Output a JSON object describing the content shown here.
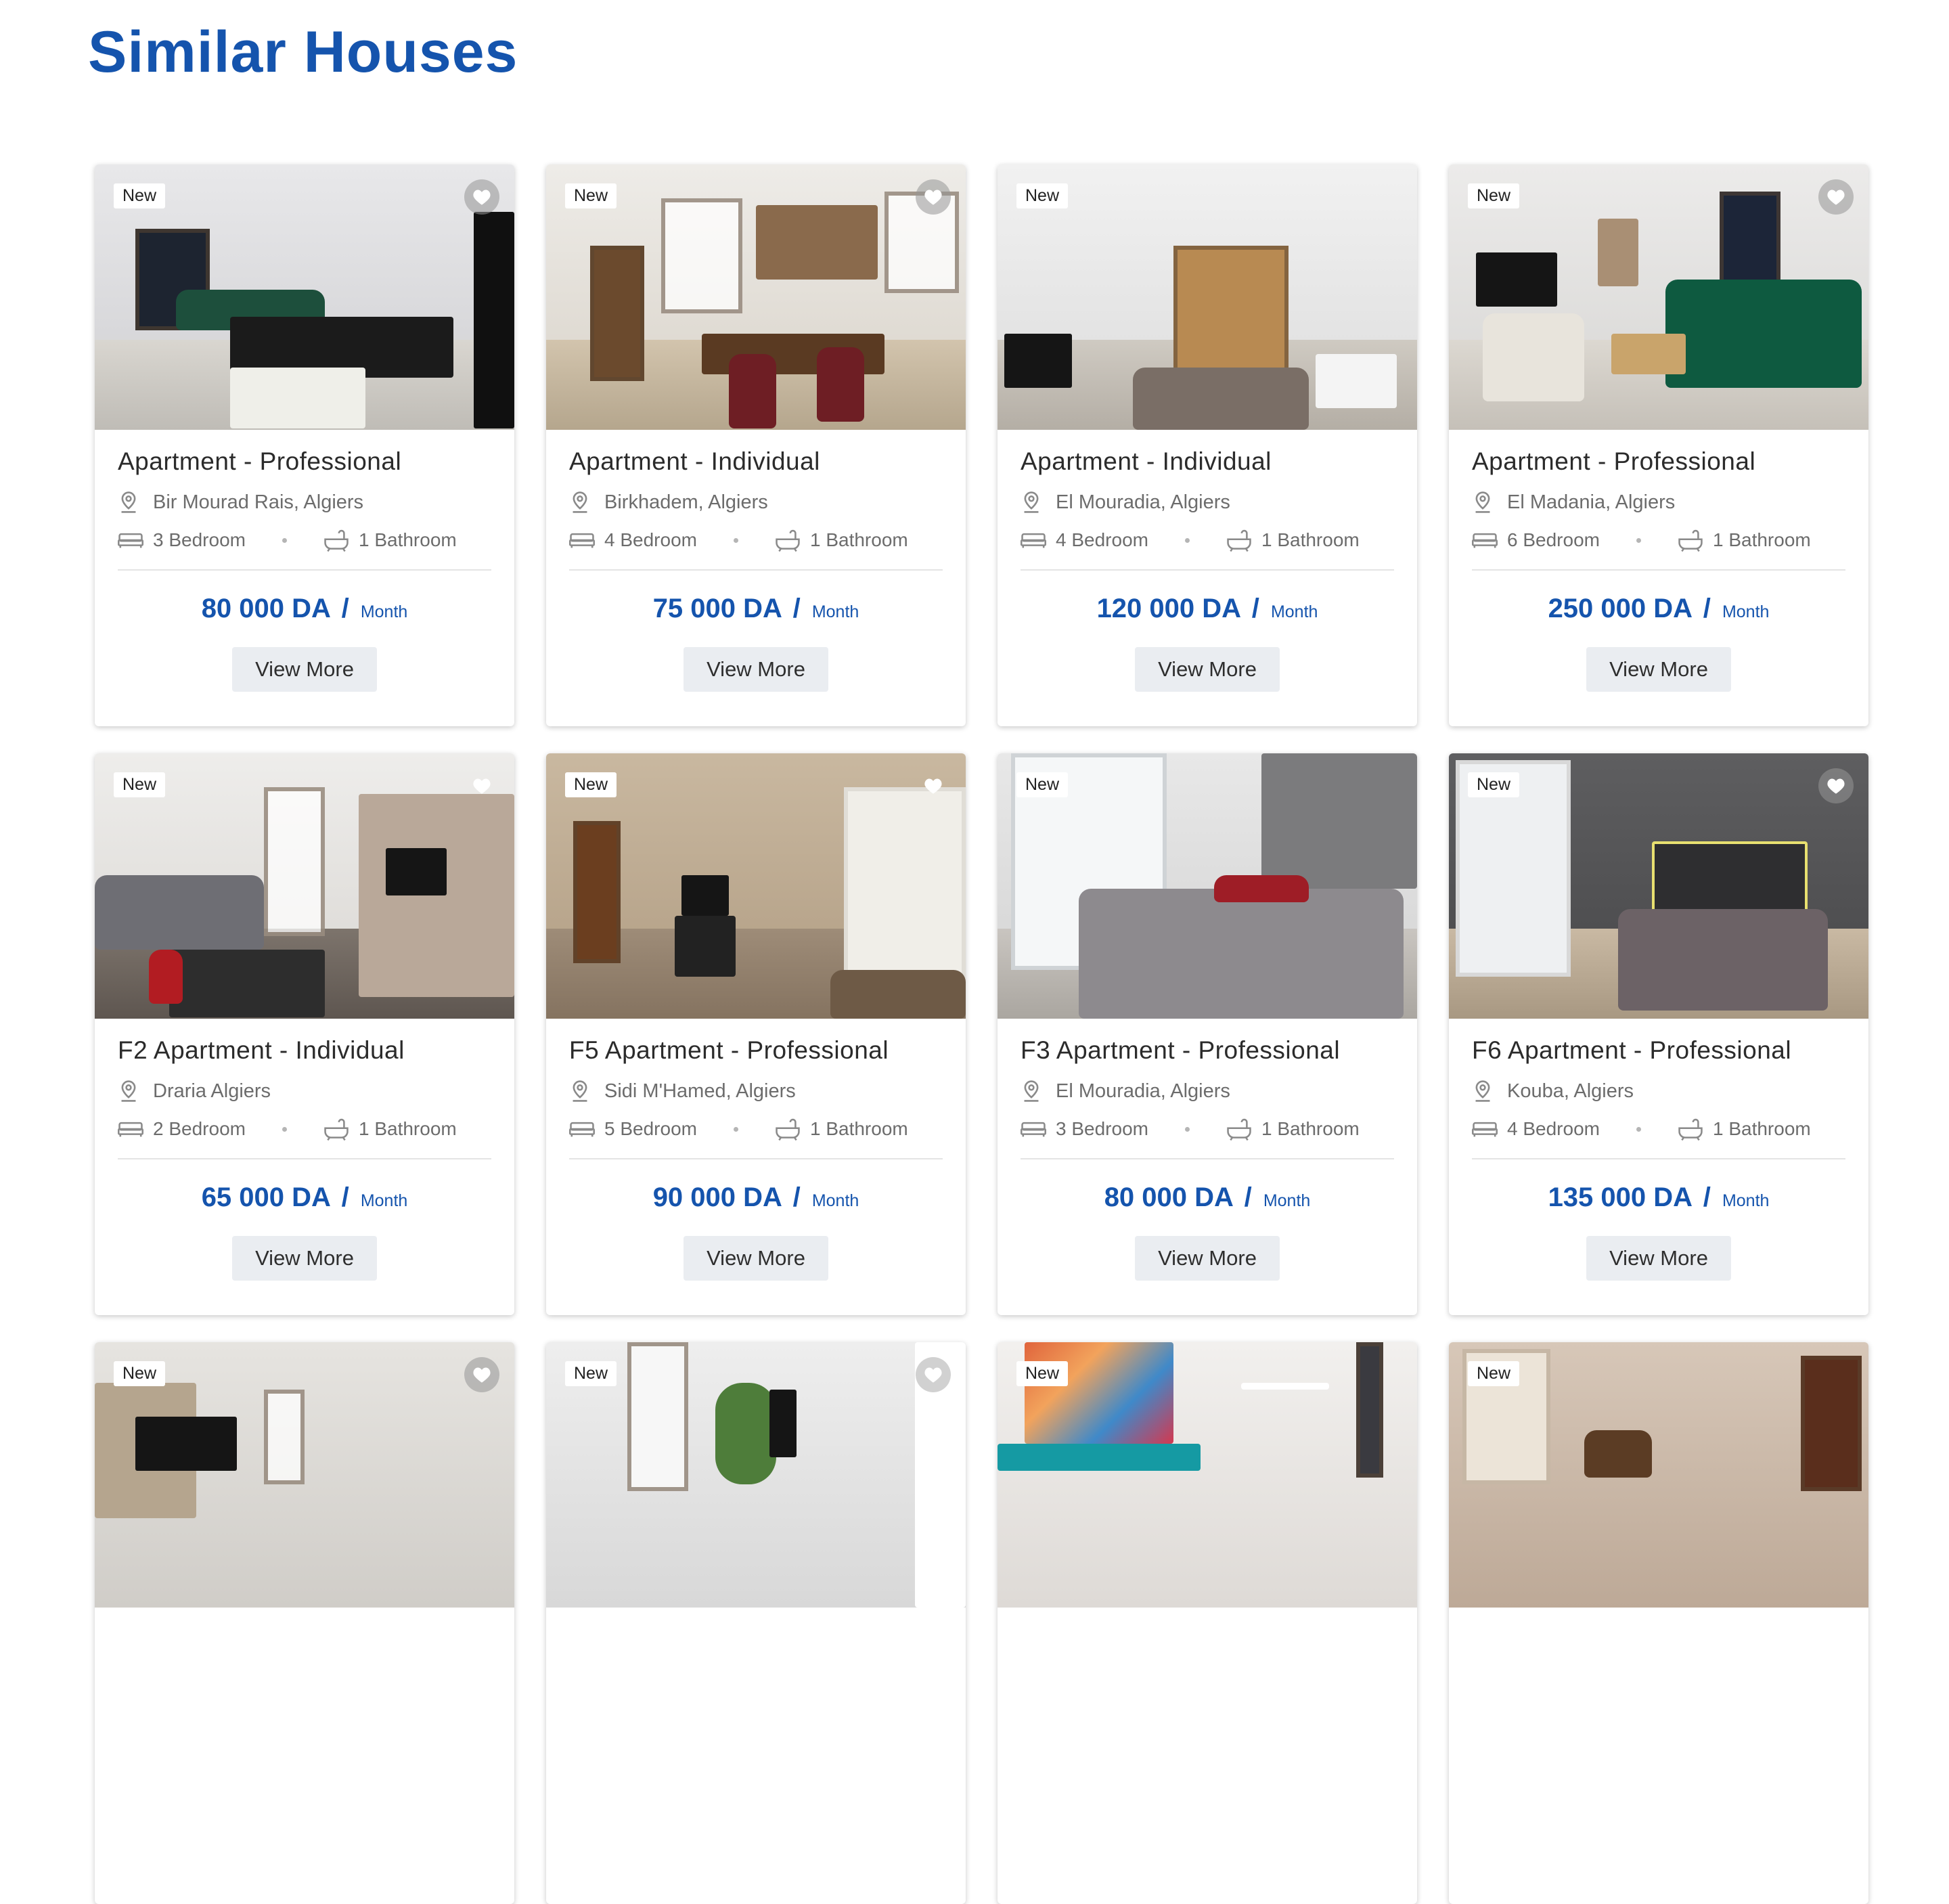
{
  "page": {
    "title": "Similar Houses"
  },
  "listings": [
    {
      "badge": "New",
      "title": "Apartment -  Professional",
      "location": "Bir Mourad Rais, Algiers",
      "bedrooms": "3 Bedroom",
      "bathrooms": "1 Bathroom",
      "price": "80 000 DA",
      "price_sep": "/",
      "price_unit": "Month",
      "cta": "View More"
    },
    {
      "badge": "New",
      "title": "Apartment - Individual",
      "location": "Birkhadem, Algiers",
      "bedrooms": "4 Bedroom",
      "bathrooms": "1 Bathroom",
      "price": "75 000 DA",
      "price_sep": "/",
      "price_unit": "Month",
      "cta": "View More"
    },
    {
      "badge": "New",
      "title": "Apartment -  Individual",
      "location": "El Mouradia, Algiers",
      "bedrooms": "4 Bedroom",
      "bathrooms": "1 Bathroom",
      "price": "120 000 DA",
      "price_sep": "/",
      "price_unit": "Month",
      "cta": "View More"
    },
    {
      "badge": "New",
      "title": "Apartment -  Professional",
      "location": "El Madania, Algiers",
      "bedrooms": "6 Bedroom",
      "bathrooms": "1 Bathroom",
      "price": "250 000 DA",
      "price_sep": "/",
      "price_unit": "Month",
      "cta": "View More"
    },
    {
      "badge": "New",
      "title": "F2 Apartment - Individual",
      "location": "Draria Algiers",
      "bedrooms": "2 Bedroom",
      "bathrooms": "1 Bathroom",
      "price": "65 000 DA",
      "price_sep": "/",
      "price_unit": "Month",
      "cta": "View More"
    },
    {
      "badge": "New",
      "title": "F5 Apartment -  Professional",
      "location": "Sidi M'Hamed, Algiers",
      "bedrooms": "5 Bedroom",
      "bathrooms": "1 Bathroom",
      "price": "90 000 DA",
      "price_sep": "/",
      "price_unit": "Month",
      "cta": "View More"
    },
    {
      "badge": "New",
      "title": "F3 Apartment -  Professional",
      "location": "El Mouradia, Algiers",
      "bedrooms": "3 Bedroom",
      "bathrooms": "1 Bathroom",
      "price": "80 000 DA",
      "price_sep": "/",
      "price_unit": "Month",
      "cta": "View More"
    },
    {
      "badge": "New",
      "title": "F6 Apartment -  Professional",
      "location": "Kouba, Algiers",
      "bedrooms": "4 Bedroom",
      "bathrooms": "1 Bathroom",
      "price": "135 000 DA",
      "price_sep": "/",
      "price_unit": "Month",
      "cta": "View More"
    },
    {
      "badge": "New"
    },
    {
      "badge": "New"
    },
    {
      "badge": "New"
    },
    {
      "badge": "New"
    }
  ],
  "icons": {
    "location": "map-pin-icon",
    "bedroom": "bed-icon",
    "bathroom": "bathtub-icon",
    "favorite": "heart-icon"
  },
  "colors": {
    "accent": "#1554ad",
    "button_bg": "#eaedf1",
    "muted_text": "#6c6c6c"
  }
}
